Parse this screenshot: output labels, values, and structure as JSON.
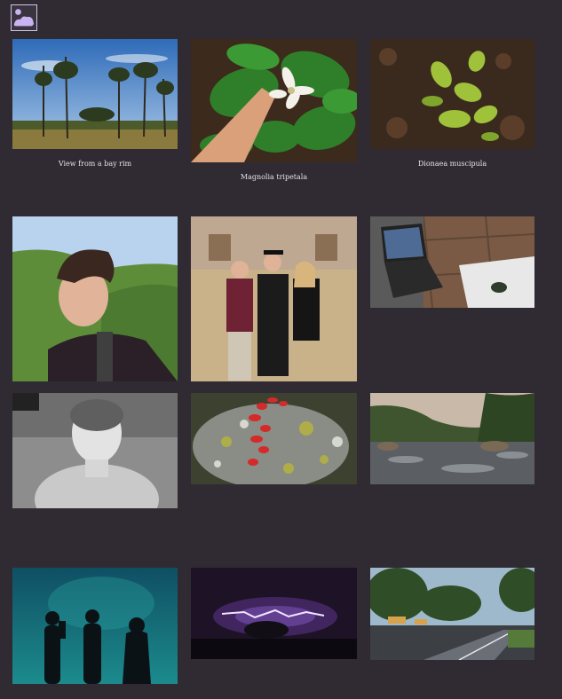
{
  "header": {
    "logo_icon": "landscape-placeholder-icon",
    "accent": "#c9b3f0"
  },
  "gallery": {
    "photos": [
      {
        "id": "bay-rim",
        "caption": "View from a bay rim"
      },
      {
        "id": "magnolia",
        "caption": "Magnolia tripetala"
      },
      {
        "id": "dionaea",
        "caption": "Dionaea muscipula"
      },
      {
        "id": "portrait-trail",
        "caption": ""
      },
      {
        "id": "graduation",
        "caption": ""
      },
      {
        "id": "laptop",
        "caption": ""
      },
      {
        "id": "thermal",
        "caption": ""
      },
      {
        "id": "lichen",
        "caption": ""
      },
      {
        "id": "river",
        "caption": ""
      },
      {
        "id": "aquarium",
        "caption": ""
      },
      {
        "id": "lightning",
        "caption": ""
      },
      {
        "id": "street",
        "caption": ""
      }
    ]
  }
}
